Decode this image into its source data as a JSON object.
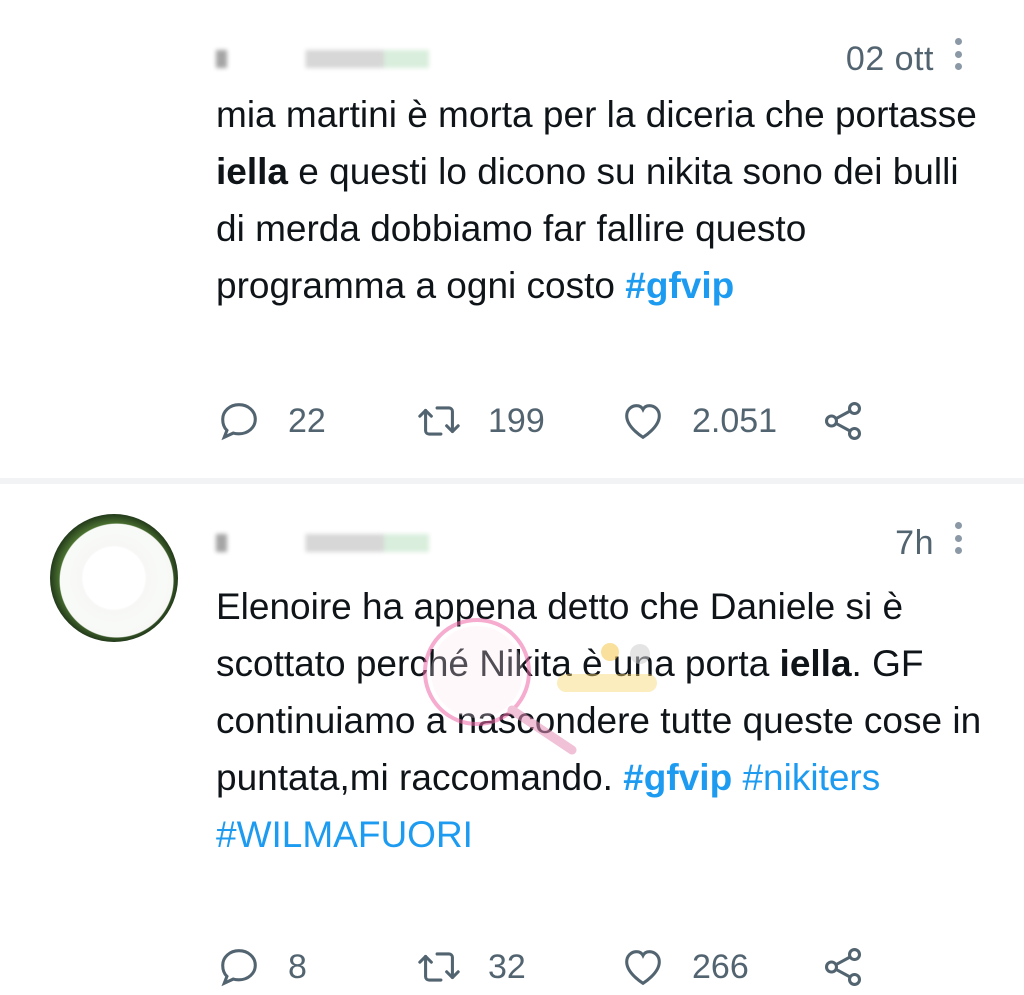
{
  "tweets": [
    {
      "time": "02 ott",
      "text": {
        "p1": "mia martini è morta per la diceria che portasse ",
        "bold1": "iella",
        "p2": " e questi lo dicono su nikita sono dei bulli di merda dobbiamo far fallire questo programma a ogni costo ",
        "tag1": "#gfvip"
      },
      "counts": {
        "replies": "22",
        "retweets": "199",
        "likes": "2.051"
      }
    },
    {
      "time": "7h",
      "text": {
        "p1": "Elenoire ha appena detto che Daniele si è scottato perché Nikita è una porta ",
        "bold1": "iella",
        "p2": ". GF continuiamo a nascondere tutte queste cose in puntata,mi raccomando. ",
        "tag1": "#gfvip",
        "tag2": "#nikiters",
        "tag3": "#WILMAFUORI"
      },
      "counts": {
        "replies": "8",
        "retweets": "32",
        "likes": "266"
      }
    }
  ],
  "icons": {
    "reply": "reply-icon",
    "retweet": "retweet-icon",
    "like": "heart-icon",
    "share": "share-icon",
    "more": "more-vertical-icon"
  },
  "colors": {
    "hashtag": "#1d9bf0",
    "secondary_text": "#536471",
    "icon": "#536471"
  }
}
